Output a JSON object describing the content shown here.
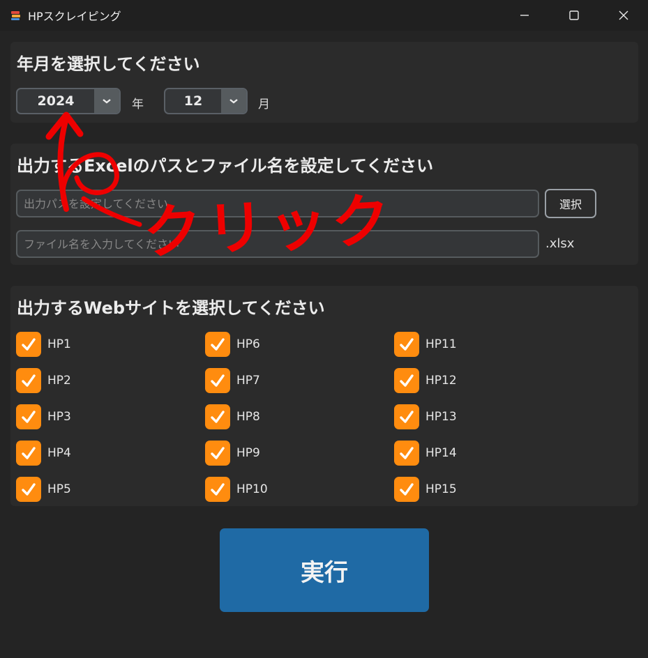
{
  "window": {
    "title": "HPスクレイピング",
    "app_icon": "app-logo-icon",
    "controls": [
      "minimize-icon",
      "maximize-icon",
      "close-icon"
    ]
  },
  "date_section": {
    "title": "年月を選択してください",
    "year_value": "2024",
    "year_unit": "年",
    "month_value": "12",
    "month_unit": "月"
  },
  "output_section": {
    "title": "出力するExcelのパスとファイル名を設定してください",
    "path_placeholder": "出力パスを設定してください",
    "path_value": "",
    "select_button": "選択",
    "filename_placeholder": "ファイル名を入力してください",
    "filename_value": "",
    "extension": ".xlsx"
  },
  "sites_section": {
    "title": "出力するWebサイトを選択してください",
    "sites": [
      {
        "label": "HP1",
        "checked": true
      },
      {
        "label": "HP2",
        "checked": true
      },
      {
        "label": "HP3",
        "checked": true
      },
      {
        "label": "HP4",
        "checked": true
      },
      {
        "label": "HP5",
        "checked": true
      },
      {
        "label": "HP6",
        "checked": true
      },
      {
        "label": "HP7",
        "checked": true
      },
      {
        "label": "HP8",
        "checked": true
      },
      {
        "label": "HP9",
        "checked": true
      },
      {
        "label": "HP10",
        "checked": true
      },
      {
        "label": "HP11",
        "checked": true
      },
      {
        "label": "HP12",
        "checked": true
      },
      {
        "label": "HP13",
        "checked": true
      },
      {
        "label": "HP14",
        "checked": true
      },
      {
        "label": "HP15",
        "checked": true
      }
    ]
  },
  "run_button": "実行",
  "annotation": {
    "text": "クリック",
    "color": "#ee0000"
  },
  "colors": {
    "accent_checkbox": "#ff8c0f",
    "run_button": "#1f6aa5",
    "background": "#242424",
    "panel": "#2b2b2b"
  }
}
